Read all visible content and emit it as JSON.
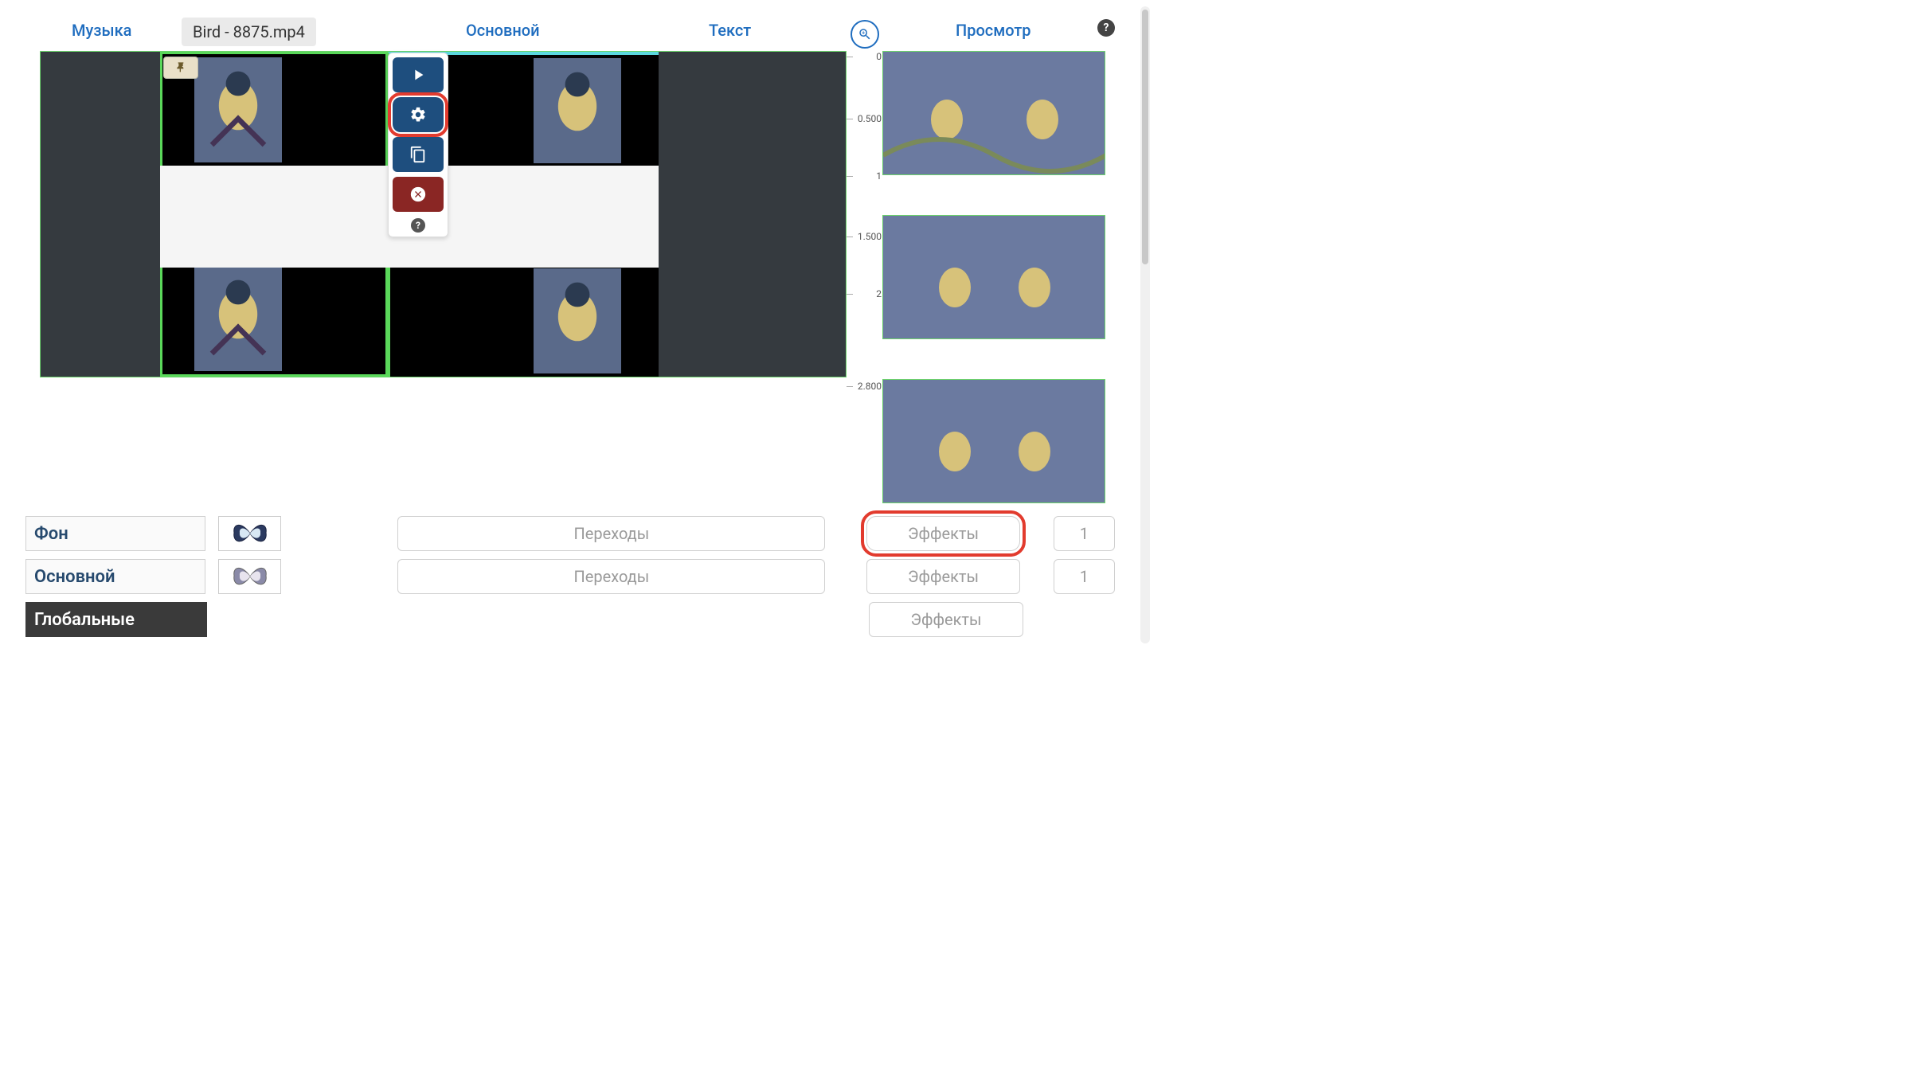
{
  "tabs": {
    "music": "Музыка",
    "main": "Основной",
    "text": "Текст",
    "view": "Просмотр"
  },
  "clip_chip": "Bird - 8875.mp4",
  "tool_popup": {
    "play": "play",
    "settings": "settings",
    "copy": "copy",
    "delete": "delete",
    "help": "?"
  },
  "ruler_ticks": [
    "0",
    "0.500",
    "1",
    "1.500",
    "2",
    "2.800"
  ],
  "layers": [
    {
      "label": "Фон",
      "transitions": "Переходы",
      "effects": "Эффекты",
      "count": "1",
      "highlight_effects": true
    },
    {
      "label": "Основной",
      "transitions": "Переходы",
      "effects": "Эффекты",
      "count": "1",
      "highlight_effects": false
    },
    {
      "label": "Глобальные",
      "transitions": "",
      "effects": "Эффекты",
      "count": "",
      "highlight_effects": false
    }
  ],
  "help": "?"
}
